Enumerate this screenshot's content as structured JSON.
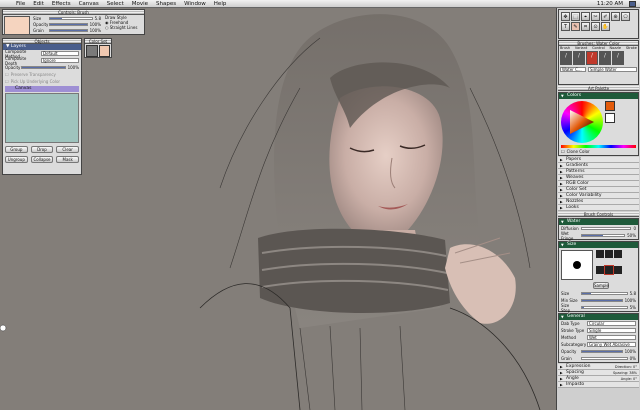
{
  "menubar": {
    "items": [
      "File",
      "Edit",
      "Effects",
      "Canvas",
      "Select",
      "Movie",
      "Shapes",
      "Window",
      "Help"
    ],
    "clock": "11:20 AM"
  },
  "brush_ctl": {
    "title": "Controls: Brush",
    "size_label": "Size",
    "size_value": "5.8",
    "opacity_label": "Opacity",
    "opacity_value": "100%",
    "grain_label": "Grain",
    "grain_value": "100%",
    "draw_style_label": "Draw Style",
    "freehand_label": "Freehand",
    "straight_label": "Straight Lines"
  },
  "layers": {
    "tab_objects": "Objects",
    "tab_layers": "Layers",
    "composite_method_label": "Composite Method",
    "composite_method_value": "Default",
    "composite_depth_label": "Composite Depth",
    "composite_depth_value": "Ignore",
    "opacity_label": "Opacity",
    "opacity_value": "100%",
    "preserve_label": "Preserve Transparency",
    "pick_up_label": "Pick Up Underlying Color",
    "canvas_label": "Canvas",
    "buttons": [
      "Group",
      "Drop",
      "Clear",
      "Ungroup",
      "Collapse",
      "Mask"
    ]
  },
  "color_set": {
    "title": "Color Set"
  },
  "toolbox": {
    "tools": [
      "✥",
      "⬚",
      "⌖",
      "✂",
      "✐",
      "⊕",
      "⬠",
      "T",
      "✎",
      "⌗",
      "⊙",
      "✋"
    ]
  },
  "brush_selector": {
    "title": "Brushes: Water Color",
    "tabs": [
      "Brush",
      "Variant",
      "Control",
      "Nozzle",
      "Stroke"
    ],
    "category": "Water C...",
    "variant": "Simple Water"
  },
  "art_palette": {
    "title": "Art Palette"
  },
  "colors": {
    "title": "Colors",
    "clone_label": "Clone Color",
    "hue_color": "#e25a0a"
  },
  "palette_list": [
    "Papers",
    "Gradients",
    "Patterns",
    "Weaves",
    "RGB Color",
    "Color Set",
    "Color Variability",
    "Nozzles",
    "Looks"
  ],
  "brush_controls": {
    "title": "Brush Controls",
    "water": {
      "title": "Water",
      "diffusion_label": "Diffusion",
      "diffusion_value": "0",
      "wet_fringe_label": "Wet Fringe",
      "wet_fringe_value": "50%"
    },
    "size": {
      "title": "Size",
      "size_label": "Size",
      "size_value": "5.8",
      "min_size_label": "Min Size",
      "min_size_value": "100%",
      "size_step_label": "Size Step",
      "size_step_value": "5%",
      "sample_label": "Sample"
    },
    "general": {
      "title": "General",
      "dab_type_label": "Dab Type",
      "dab_type_value": "Circular",
      "stroke_type_label": "Stroke Type",
      "stroke_type_value": "Single",
      "method_label": "Method",
      "method_value": "Wet",
      "subcategory_label": "Subcategory",
      "subcategory_value": "Grainy Wet Abrasive",
      "opacity_label": "Opacity",
      "opacity_value": "100%",
      "grain_label": "Grain",
      "grain_value": "0%"
    },
    "collapsed": [
      {
        "label": "Expression",
        "extra": "Direction: 0°"
      },
      {
        "label": "Spacing",
        "extra": "Spacing: 38%"
      },
      {
        "label": "Angle",
        "extra": "Angle: 0°"
      },
      {
        "label": "Impasto",
        "extra": ""
      }
    ]
  }
}
